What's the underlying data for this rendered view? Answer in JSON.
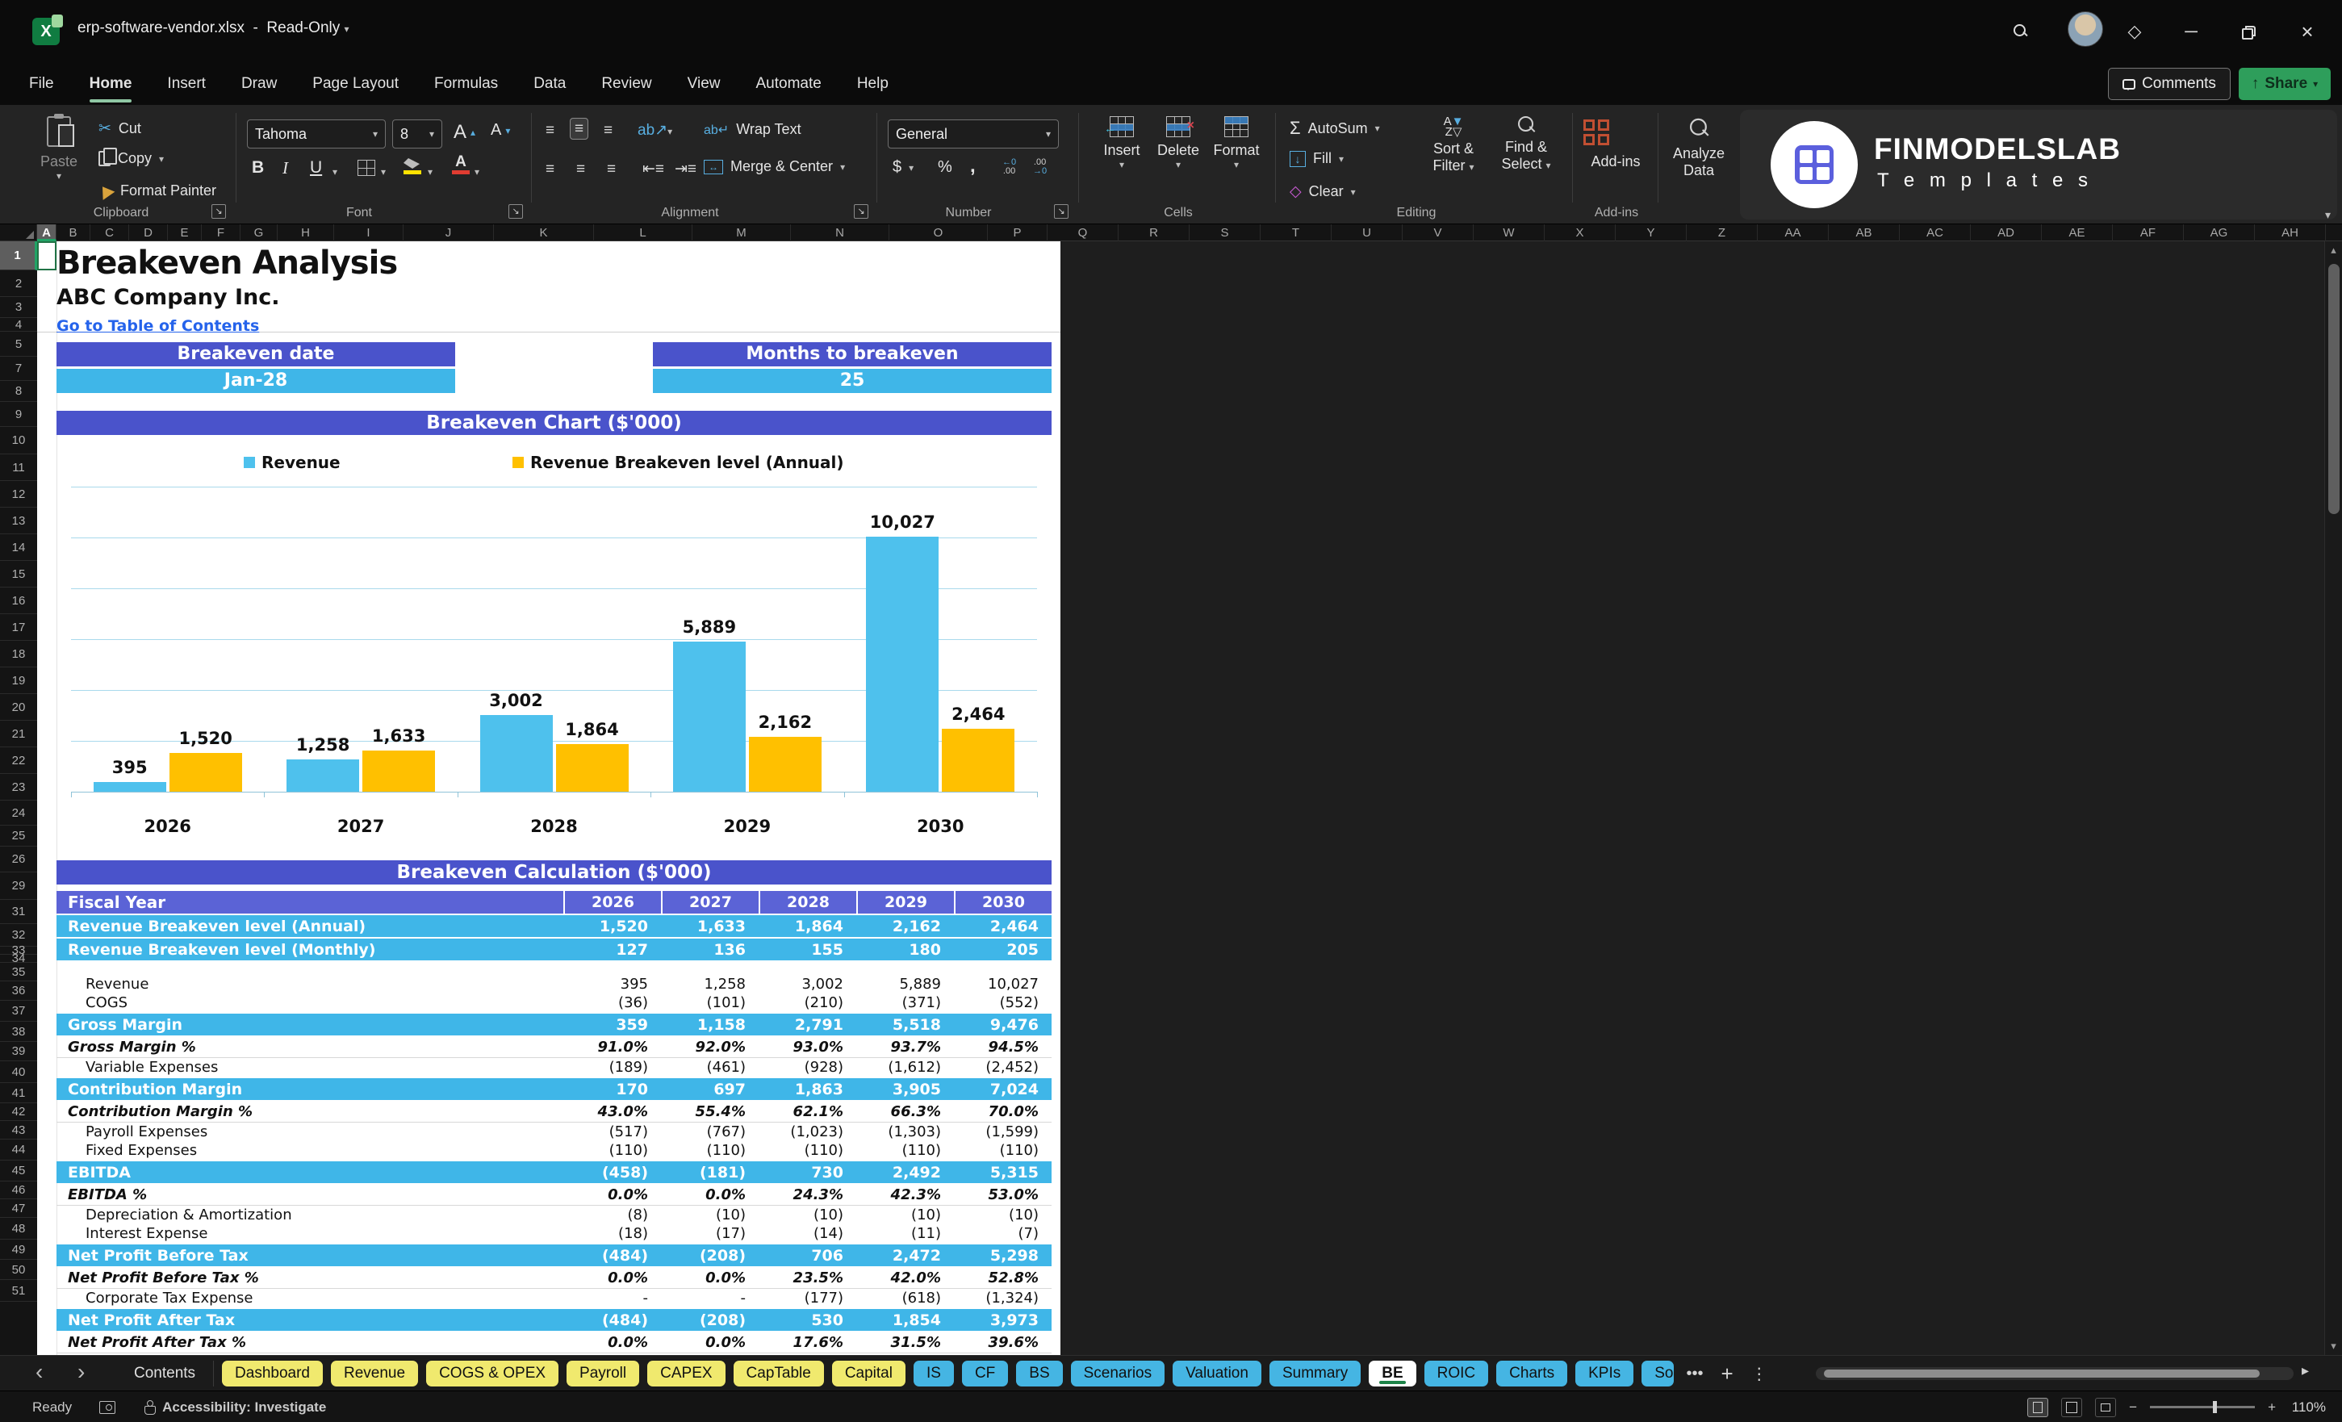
{
  "title_bar": {
    "file_name": "erp-software-vendor.xlsx",
    "separator": "-",
    "mode": "Read-Only"
  },
  "menu": {
    "items": [
      "File",
      "Home",
      "Insert",
      "Draw",
      "Page Layout",
      "Formulas",
      "Data",
      "Review",
      "View",
      "Automate",
      "Help"
    ],
    "active_item": "Home",
    "comments_label": "Comments",
    "share_label": "Share"
  },
  "ribbon": {
    "paste": "Paste",
    "cut": "Cut",
    "copy": "Copy",
    "format_painter": "Format Painter",
    "clipboard_group": "Clipboard",
    "font_name": "Tahoma",
    "font_size": "8",
    "font_group": "Font",
    "wrap_text": "Wrap Text",
    "merge_center": "Merge & Center",
    "alignment_group": "Alignment",
    "number_format": "General",
    "number_group": "Number",
    "insert": "Insert",
    "delete": "Delete",
    "format": "Format",
    "cells_group": "Cells",
    "autosum": "AutoSum",
    "fill": "Fill",
    "clear": "Clear",
    "sort_filter_1": "Sort &",
    "sort_filter_2": "Filter",
    "find_select_1": "Find &",
    "find_select_2": "Select",
    "editing_group": "Editing",
    "addins": "Add-ins",
    "addins_group": "Add-ins",
    "analyze_1": "Analyze",
    "analyze_2": "Data"
  },
  "brand": {
    "name": "FINMODELSLAB",
    "subtitle": "T e m p l a t e s"
  },
  "grid": {
    "columns": [
      "A",
      "B",
      "C",
      "D",
      "E",
      "F",
      "G",
      "H",
      "I",
      "J",
      "K",
      "L",
      "M",
      "N",
      "O",
      "P",
      "Q",
      "R",
      "S",
      "T",
      "U",
      "V",
      "W",
      "X",
      "Y",
      "Z",
      "AA",
      "AB",
      "AC",
      "AD",
      "AE",
      "AF",
      "AG",
      "AH"
    ],
    "selected_column": "A",
    "rows": [
      "1",
      "2",
      "3",
      "4",
      "5",
      "7",
      "8",
      "9",
      "10",
      "11",
      "12",
      "13",
      "14",
      "15",
      "16",
      "17",
      "18",
      "19",
      "20",
      "21",
      "22",
      "23",
      "24",
      "25",
      "26",
      "29",
      "31",
      "32",
      "33",
      "34",
      "35",
      "36",
      "37",
      "38",
      "39",
      "40",
      "41",
      "42",
      "43",
      "44",
      "45",
      "46",
      "47",
      "48",
      "49",
      "50",
      "51"
    ],
    "selected_row": "1"
  },
  "sheet": {
    "title": "Breakeven Analysis",
    "company": "ABC Company Inc.",
    "link": "Go to Table of Contents",
    "kpis": [
      {
        "label": "Breakeven date",
        "value": "Jan-28"
      },
      {
        "label": "Months to breakeven",
        "value": "25"
      }
    ],
    "table": {
      "banner": "Breakeven Calculation ($'000)",
      "header": [
        "Fiscal Year",
        "2026",
        "2027",
        "2028",
        "2029",
        "2030"
      ],
      "rows": [
        {
          "label": "Revenue Breakeven level (Annual)",
          "type": "cyan",
          "values": [
            "1,520",
            "1,633",
            "1,864",
            "2,162",
            "2,464"
          ]
        },
        {
          "label": "Revenue Breakeven level (Monthly)",
          "type": "cyan",
          "values": [
            "127",
            "136",
            "155",
            "180",
            "205"
          ]
        },
        {
          "label": "",
          "type": "spacer",
          "values": [
            "",
            "",
            "",
            "",
            ""
          ]
        },
        {
          "label": "Revenue",
          "type": "detail",
          "values": [
            "395",
            "1,258",
            "3,002",
            "5,889",
            "10,027"
          ]
        },
        {
          "label": "COGS",
          "type": "detail",
          "values": [
            "(36)",
            "(101)",
            "(210)",
            "(371)",
            "(552)"
          ]
        },
        {
          "label": "Gross Margin",
          "type": "cyan",
          "values": [
            "359",
            "1,158",
            "2,791",
            "5,518",
            "9,476"
          ]
        },
        {
          "label": "Gross Margin %",
          "type": "pct",
          "values": [
            "91.0%",
            "92.0%",
            "93.0%",
            "93.7%",
            "94.5%"
          ]
        },
        {
          "label": "Variable Expenses",
          "type": "detail",
          "values": [
            "(189)",
            "(461)",
            "(928)",
            "(1,612)",
            "(2,452)"
          ]
        },
        {
          "label": "Contribution Margin",
          "type": "cyan",
          "values": [
            "170",
            "697",
            "1,863",
            "3,905",
            "7,024"
          ]
        },
        {
          "label": "Contribution Margin %",
          "type": "pct",
          "values": [
            "43.0%",
            "55.4%",
            "62.1%",
            "66.3%",
            "70.0%"
          ]
        },
        {
          "label": "Payroll Expenses",
          "type": "detail",
          "values": [
            "(517)",
            "(767)",
            "(1,023)",
            "(1,303)",
            "(1,599)"
          ]
        },
        {
          "label": "Fixed Expenses",
          "type": "detail",
          "values": [
            "(110)",
            "(110)",
            "(110)",
            "(110)",
            "(110)"
          ]
        },
        {
          "label": "EBITDA",
          "type": "cyan",
          "values": [
            "(458)",
            "(181)",
            "730",
            "2,492",
            "5,315"
          ]
        },
        {
          "label": "EBITDA %",
          "type": "pct",
          "values": [
            "0.0%",
            "0.0%",
            "24.3%",
            "42.3%",
            "53.0%"
          ]
        },
        {
          "label": "Depreciation & Amortization",
          "type": "detail",
          "values": [
            "(8)",
            "(10)",
            "(10)",
            "(10)",
            "(10)"
          ]
        },
        {
          "label": "Interest Expense",
          "type": "detail",
          "values": [
            "(18)",
            "(17)",
            "(14)",
            "(11)",
            "(7)"
          ]
        },
        {
          "label": "Net Profit Before Tax",
          "type": "cyan",
          "values": [
            "(484)",
            "(208)",
            "706",
            "2,472",
            "5,298"
          ]
        },
        {
          "label": "Net Profit Before Tax %",
          "type": "pct",
          "values": [
            "0.0%",
            "0.0%",
            "23.5%",
            "42.0%",
            "52.8%"
          ]
        },
        {
          "label": "Corporate Tax Expense",
          "type": "detail",
          "values": [
            "-",
            "-",
            "(177)",
            "(618)",
            "(1,324)"
          ]
        },
        {
          "label": "Net Profit After Tax",
          "type": "cyan",
          "values": [
            "(484)",
            "(208)",
            "530",
            "1,854",
            "3,973"
          ]
        },
        {
          "label": "Net Profit After Tax %",
          "type": "pct",
          "values": [
            "0.0%",
            "0.0%",
            "17.6%",
            "31.5%",
            "39.6%"
          ]
        }
      ]
    }
  },
  "chart_data": {
    "type": "bar",
    "title": "Breakeven Chart ($'000)",
    "categories": [
      "2026",
      "2027",
      "2028",
      "2029",
      "2030"
    ],
    "series": [
      {
        "name": "Revenue",
        "color": "#4EC1ED",
        "values": [
          395,
          1258,
          3002,
          5889,
          10027
        ],
        "labels": [
          "395",
          "1,258",
          "3,002",
          "5,889",
          "10,027"
        ]
      },
      {
        "name": "Revenue Breakeven level (Annual)",
        "color": "#FFC000",
        "values": [
          1520,
          1633,
          1864,
          2162,
          2464
        ],
        "labels": [
          "1,520",
          "1,633",
          "1,864",
          "2,162",
          "2,464"
        ]
      }
    ],
    "ylim": [
      0,
      12000
    ],
    "gridline_step": 2000,
    "grid": true,
    "legend_position": "top",
    "data_labels": true
  },
  "tabs": {
    "nav_prev": "‹",
    "nav_next": "›",
    "items": [
      {
        "label": "Contents",
        "style": "plain"
      },
      {
        "label": "Dashboard",
        "style": "yellow"
      },
      {
        "label": "Revenue",
        "style": "yellow"
      },
      {
        "label": "COGS & OPEX",
        "style": "yellow"
      },
      {
        "label": "Payroll",
        "style": "yellow"
      },
      {
        "label": "CAPEX",
        "style": "yellow"
      },
      {
        "label": "CapTable",
        "style": "yellow"
      },
      {
        "label": "Capital",
        "style": "yellow"
      },
      {
        "label": "IS",
        "style": "blue"
      },
      {
        "label": "CF",
        "style": "blue"
      },
      {
        "label": "BS",
        "style": "blue"
      },
      {
        "label": "Scenarios",
        "style": "blue"
      },
      {
        "label": "Valuation",
        "style": "blue"
      },
      {
        "label": "Summary",
        "style": "blue"
      },
      {
        "label": "BE",
        "style": "active"
      },
      {
        "label": "ROIC",
        "style": "blue"
      },
      {
        "label": "Charts",
        "style": "blue"
      },
      {
        "label": "KPIs",
        "style": "blue"
      },
      {
        "label": "So",
        "style": "blue",
        "clipped": true
      }
    ],
    "overflow": "•••",
    "add": "+",
    "menu": "⋮"
  },
  "status_bar": {
    "ready": "Ready",
    "accessibility": "Accessibility: Investigate",
    "zoom_minus": "−",
    "zoom_plus": "+",
    "zoom_level": "110%"
  },
  "colors": {
    "accent_purple": "#4A53CB",
    "header_purple": "#5B63D6",
    "row_cyan": "#3FB6E8",
    "chart_blue": "#4EC1ED",
    "chart_yellow": "#FFC000",
    "tab_yellow": "#F0E96E",
    "tab_blue": "#45B5E3",
    "share_green": "#2E9E5B",
    "link_blue": "#2563EB"
  }
}
